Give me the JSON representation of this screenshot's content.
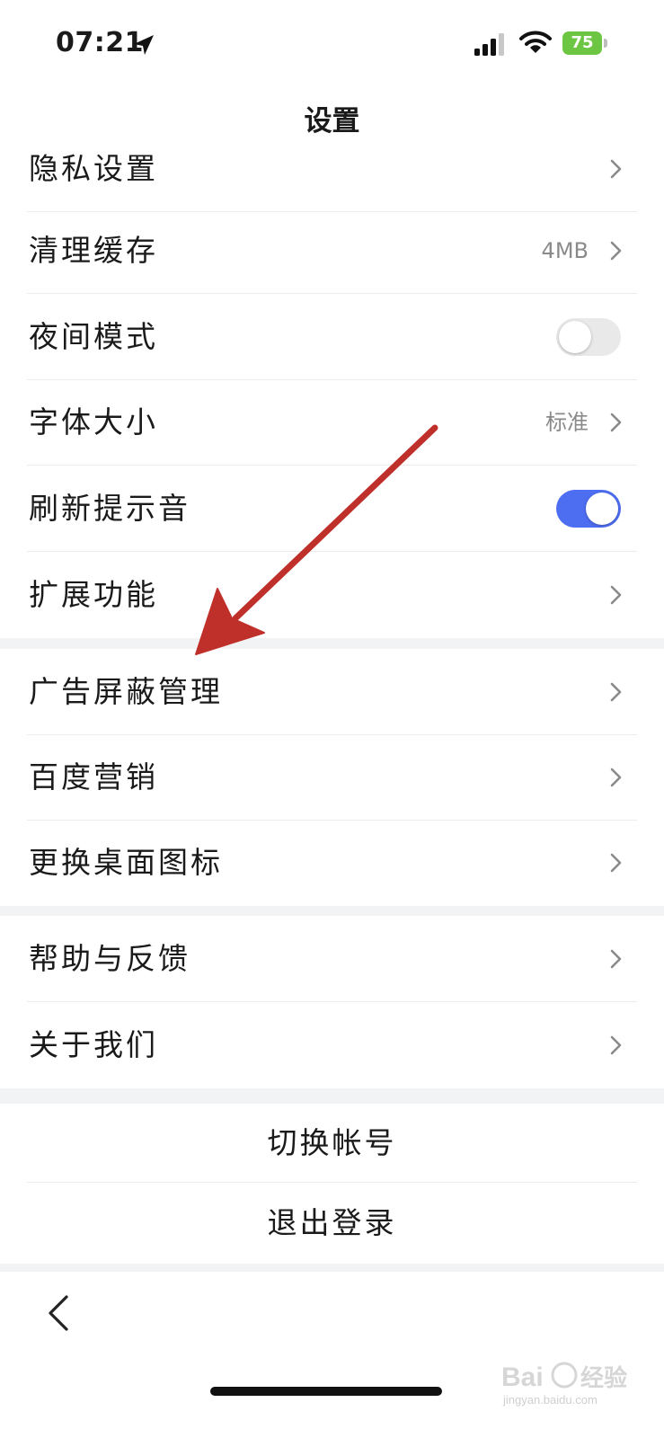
{
  "status_bar": {
    "time": "07:21",
    "battery": "75"
  },
  "nav": {
    "title": "设置"
  },
  "group1": [
    {
      "label": "隐私设置",
      "value": "",
      "control": "chevron"
    },
    {
      "label": "清理缓存",
      "value": "4MB",
      "control": "chevron"
    },
    {
      "label": "夜间模式",
      "value": "",
      "control": "toggle",
      "state": "off"
    },
    {
      "label": "字体大小",
      "value": "标准",
      "control": "chevron"
    },
    {
      "label": "刷新提示音",
      "value": "",
      "control": "toggle",
      "state": "on"
    },
    {
      "label": "扩展功能",
      "value": "",
      "control": "chevron"
    }
  ],
  "group2": [
    {
      "label": "广告屏蔽管理"
    },
    {
      "label": "百度营销"
    },
    {
      "label": "更换桌面图标"
    }
  ],
  "group3": [
    {
      "label": "帮助与反馈"
    },
    {
      "label": "关于我们"
    }
  ],
  "account": {
    "switch_label": "切换帐号",
    "logout_label": "退出登录"
  },
  "watermark": {
    "brand": "Bai",
    "brand_cn": "经验",
    "url": "jingyan.baidu.com"
  },
  "colors": {
    "toggle_on": "#4e6ef2",
    "battery": "#6cc644",
    "annotation_arrow": "#c0302b"
  }
}
